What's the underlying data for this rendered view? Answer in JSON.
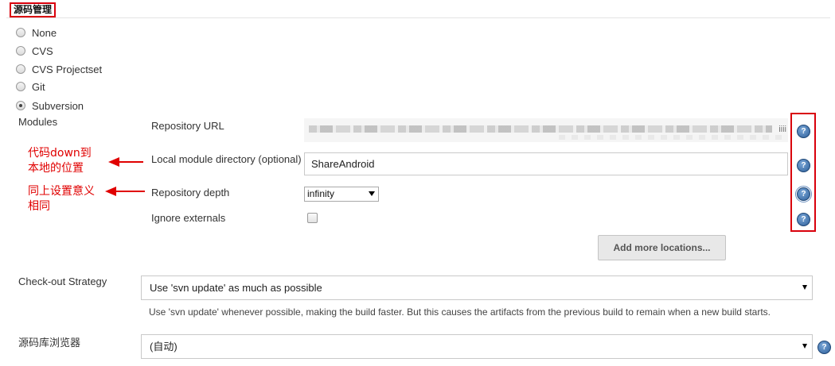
{
  "section": {
    "title": "源码管理"
  },
  "scm_options": [
    {
      "label": "None",
      "checked": false
    },
    {
      "label": "CVS",
      "checked": false
    },
    {
      "label": "CVS Projectset",
      "checked": false
    },
    {
      "label": "Git",
      "checked": false
    },
    {
      "label": "Subversion",
      "checked": true
    }
  ],
  "modules": {
    "label": "Modules",
    "repository_url": {
      "label": "Repository URL",
      "value_tail": "iiii"
    },
    "local_module_directory": {
      "label": "Local module directory (optional)",
      "value": "ShareAndroid"
    },
    "repository_depth": {
      "label": "Repository depth",
      "value": "infinity"
    },
    "ignore_externals": {
      "label": "Ignore externals",
      "checked": false
    },
    "add_more_label": "Add more locations..."
  },
  "checkout": {
    "label": "Check-out Strategy",
    "value": "Use 'svn update' as much as possible",
    "description": "Use 'svn update' whenever possible, making the build faster. But this causes the artifacts from the previous build to remain when a new build starts."
  },
  "browser": {
    "label": "源码库浏览器",
    "value": "(自动)"
  },
  "help_glyph": "?",
  "annotations": {
    "note1": "代码down到\n本地的位置",
    "note2": "同上设置意义\n相同",
    "color": "#e00000"
  },
  "colors": {
    "highlight_border": "#d9000c",
    "help_icon": "#2e5f99"
  }
}
